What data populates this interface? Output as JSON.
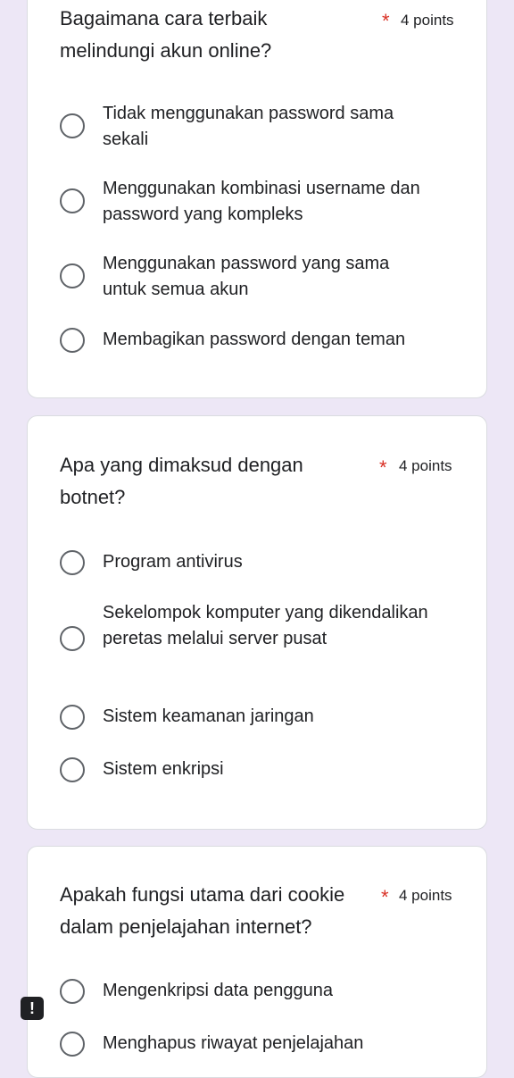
{
  "questions": [
    {
      "title": "Bagaimana cara terbaik melindungi akun online?",
      "required_mark": "*",
      "points": "4 points",
      "options": [
        "Tidak menggunakan password sama sekali",
        "Menggunakan kombinasi username dan password yang kompleks",
        "Menggunakan password yang sama untuk semua akun",
        "Membagikan password dengan teman"
      ]
    },
    {
      "title": "Apa yang dimaksud dengan botnet?",
      "required_mark": "*",
      "points": "4 points",
      "options": [
        "Program antivirus",
        "Sekelompok komputer yang dikendalikan peretas melalui server pusat",
        "Sistem keamanan jaringan",
        "Sistem enkripsi"
      ]
    },
    {
      "title": "Apakah fungsi utama dari cookie dalam penjelajahan internet?",
      "required_mark": "*",
      "points": "4 points",
      "options": [
        "Mengenkripsi data pengguna",
        "Menghapus riwayat penjelajahan"
      ]
    }
  ],
  "alert_badge": "!",
  "colors": {
    "background": "#ede7f6",
    "card": "#ffffff",
    "required": "#d93025",
    "radio_border": "#5f6368"
  }
}
